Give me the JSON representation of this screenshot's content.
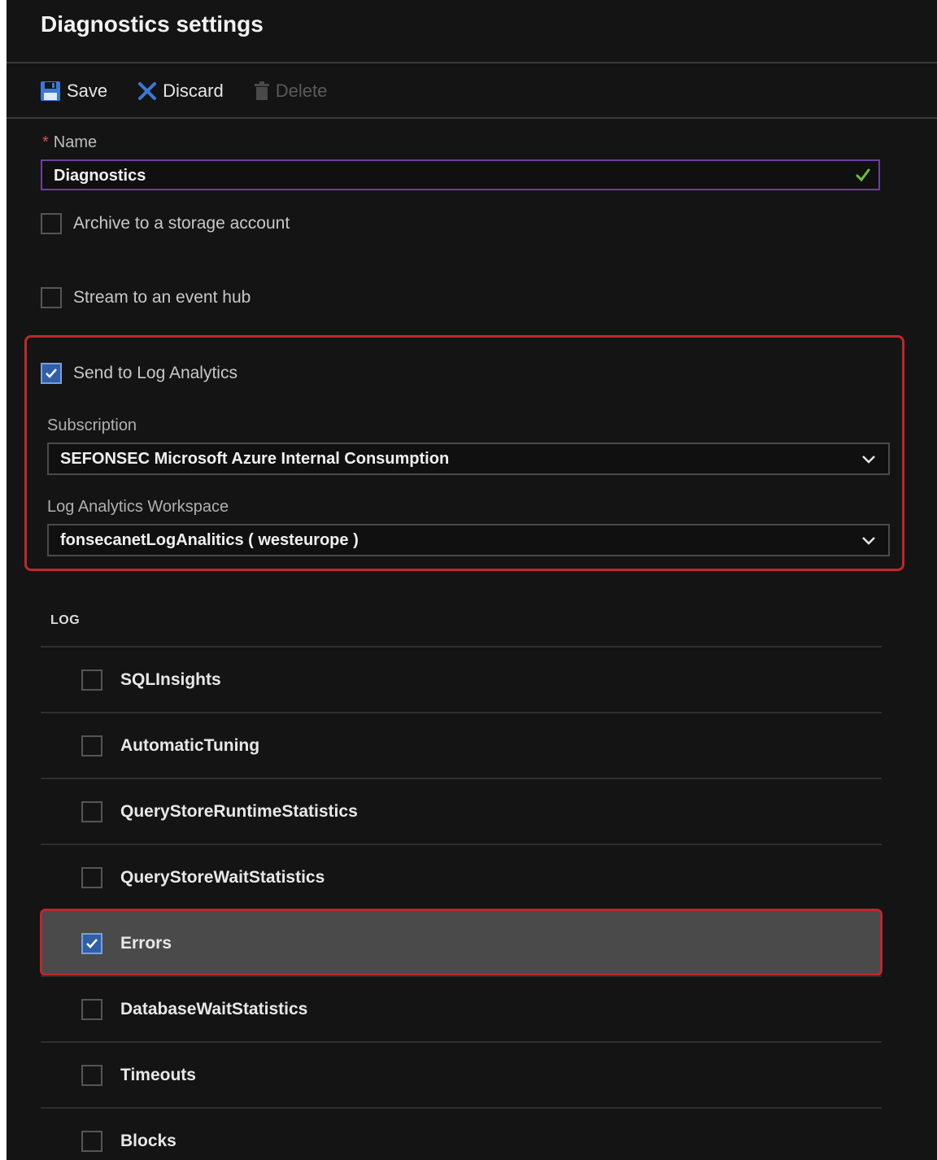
{
  "header": {
    "title": "Diagnostics settings"
  },
  "toolbar": {
    "save_label": "Save",
    "discard_label": "Discard",
    "delete_label": "Delete"
  },
  "name_field": {
    "label": "Name",
    "required_marker": "*",
    "value": "Diagnostics"
  },
  "options": {
    "archive_label": "Archive to a storage account",
    "archive_checked": false,
    "stream_label": "Stream to an event hub",
    "stream_checked": false,
    "log_analytics_label": "Send to Log Analytics",
    "log_analytics_checked": true
  },
  "log_analytics": {
    "subscription_label": "Subscription",
    "subscription_value": "SEFONSEC Microsoft Azure Internal Consumption",
    "workspace_label": "Log Analytics Workspace",
    "workspace_value": "fonsecanetLogAnalitics ( westeurope )"
  },
  "log": {
    "header": "LOG",
    "items": [
      {
        "label": "SQLInsights",
        "checked": false
      },
      {
        "label": "AutomaticTuning",
        "checked": false
      },
      {
        "label": "QueryStoreRuntimeStatistics",
        "checked": false
      },
      {
        "label": "QueryStoreWaitStatistics",
        "checked": false
      },
      {
        "label": "Errors",
        "checked": true
      },
      {
        "label": "DatabaseWaitStatistics",
        "checked": false
      },
      {
        "label": "Timeouts",
        "checked": false
      },
      {
        "label": "Blocks",
        "checked": false
      }
    ]
  },
  "colors": {
    "accent": "#2f5fa8",
    "highlight_border": "#c0262d",
    "valid_check": "#6fbf3a",
    "panel_background": "#141414"
  }
}
